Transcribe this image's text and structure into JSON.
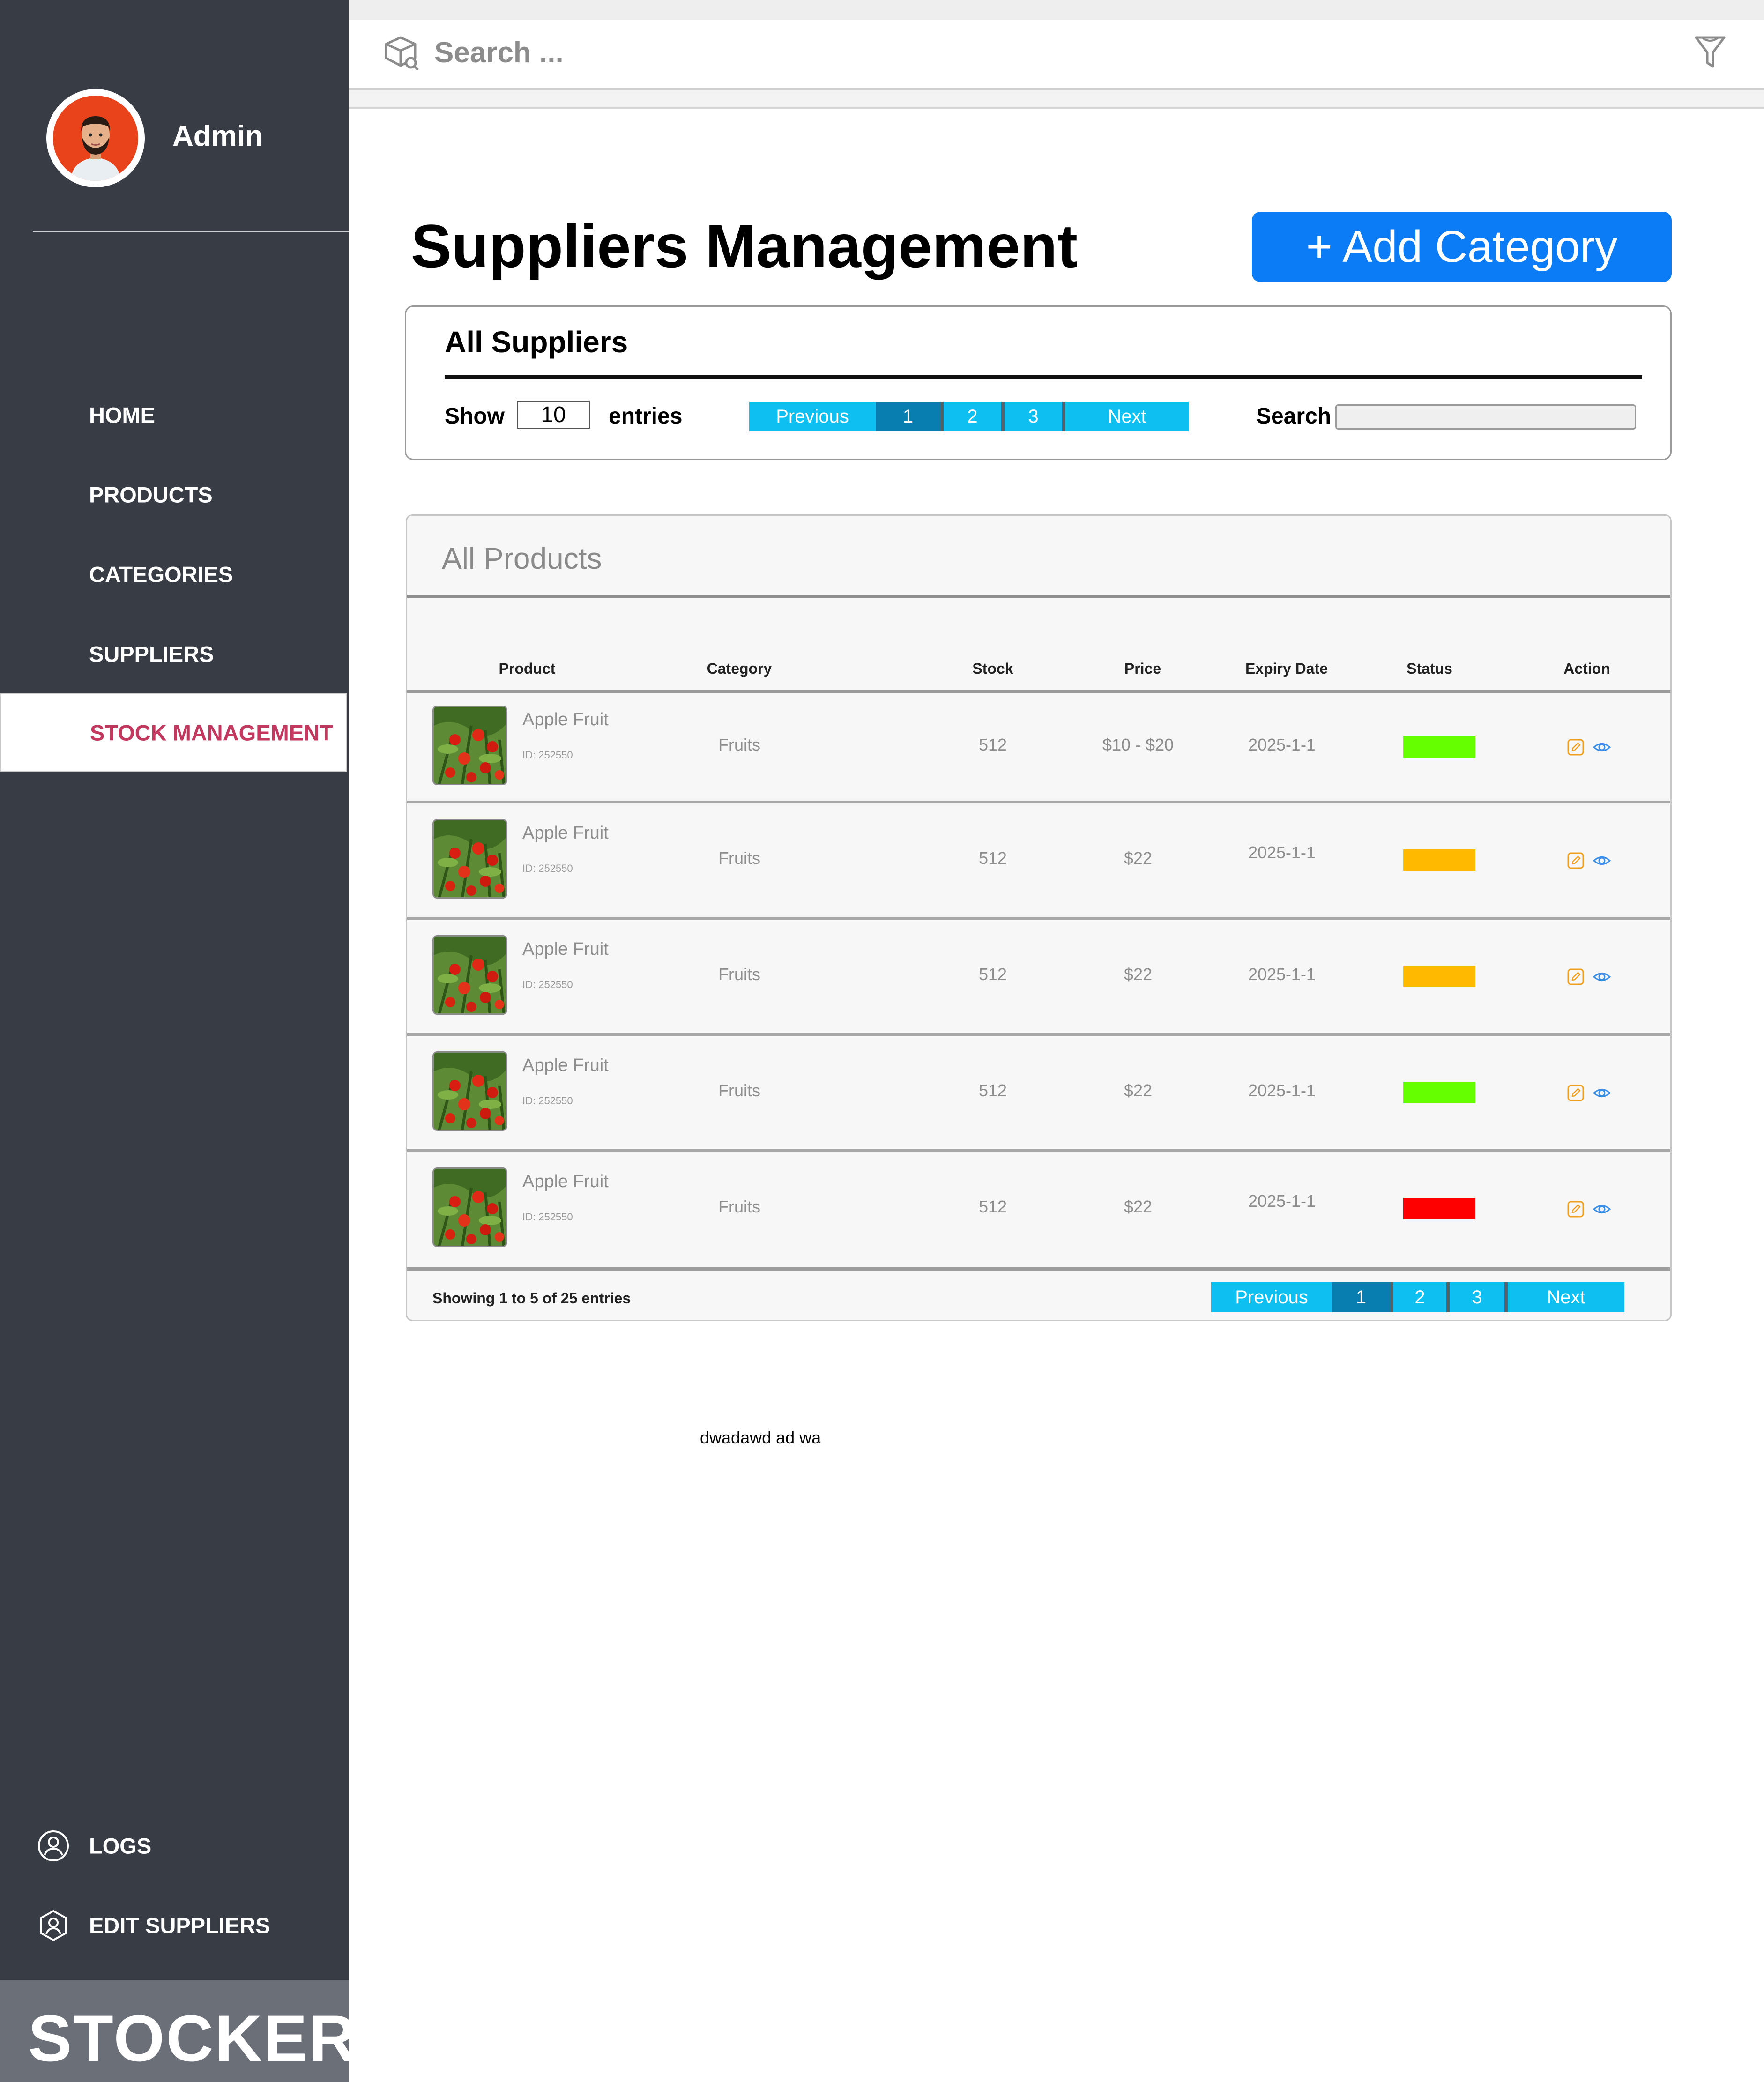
{
  "user": {
    "name": "Admin"
  },
  "nav": [
    {
      "label": "HOME"
    },
    {
      "label": "PRODUCTS"
    },
    {
      "label": "CATEGORIES"
    },
    {
      "label": "SUPPLIERS"
    },
    {
      "label": "STOCK MANAGEMENT",
      "active": true
    }
  ],
  "footer_nav": [
    {
      "label": "LOGS",
      "icon": "user-circle-icon"
    },
    {
      "label": "EDIT SUPPLIERS",
      "icon": "user-shield-icon"
    }
  ],
  "brand": "STOCKER",
  "topbar": {
    "search_placeholder": "Search ...",
    "left_icon": "box-search-icon",
    "right_icon": "filter-icon"
  },
  "page": {
    "title": "Suppliers Management",
    "add_button": "+ Add Category"
  },
  "suppliers": {
    "title": "All Suppliers",
    "show_label": "Show",
    "entries_value": "10",
    "entries_label": "entries",
    "search_label": "Search",
    "pager": {
      "previous": "Previous",
      "pages": [
        "1",
        "2",
        "3"
      ],
      "active_page": "1",
      "next": "Next"
    }
  },
  "products": {
    "title": "All Products",
    "columns": [
      "Product",
      "Category",
      "Stock",
      "Price",
      "Expiry Date",
      "Status",
      "Action"
    ],
    "rows": [
      {
        "name": "Apple Fruit",
        "id": "ID: 252550",
        "category": "Fruits",
        "stock": "512",
        "price": "$10 - $20",
        "expiry": "2025-1-1",
        "status_color": "#66ff00"
      },
      {
        "name": "Apple Fruit",
        "id": "ID: 252550",
        "category": "Fruits",
        "stock": "512",
        "price": "$22",
        "expiry": "2025-1-1",
        "status_color": "#ffbb00"
      },
      {
        "name": "Apple Fruit",
        "id": "ID: 252550",
        "category": "Fruits",
        "stock": "512",
        "price": "$22",
        "expiry": "2025-1-1",
        "status_color": "#ffbb00"
      },
      {
        "name": "Apple Fruit",
        "id": "ID: 252550",
        "category": "Fruits",
        "stock": "512",
        "price": "$22",
        "expiry": "2025-1-1",
        "status_color": "#66ff00"
      },
      {
        "name": "Apple Fruit",
        "id": "ID: 252550",
        "category": "Fruits",
        "stock": "512",
        "price": "$22",
        "expiry": "2025-1-1",
        "status_color": "#ff0000"
      }
    ],
    "action_icons": [
      "edit-icon",
      "view-icon"
    ],
    "showing_text": "Showing 1 to 5 of 25 entries",
    "pager": {
      "previous": "Previous",
      "pages": [
        "1",
        "2",
        "3"
      ],
      "active_page": "1",
      "next": "Next"
    }
  },
  "stray_text": "dwadawd ad wa",
  "colors": {
    "sidebar": "#383c45",
    "accent": "#0b7cf5",
    "pager": "#0ec0f2",
    "pager_active": "#087eb0",
    "active_nav": "#c2385e"
  }
}
